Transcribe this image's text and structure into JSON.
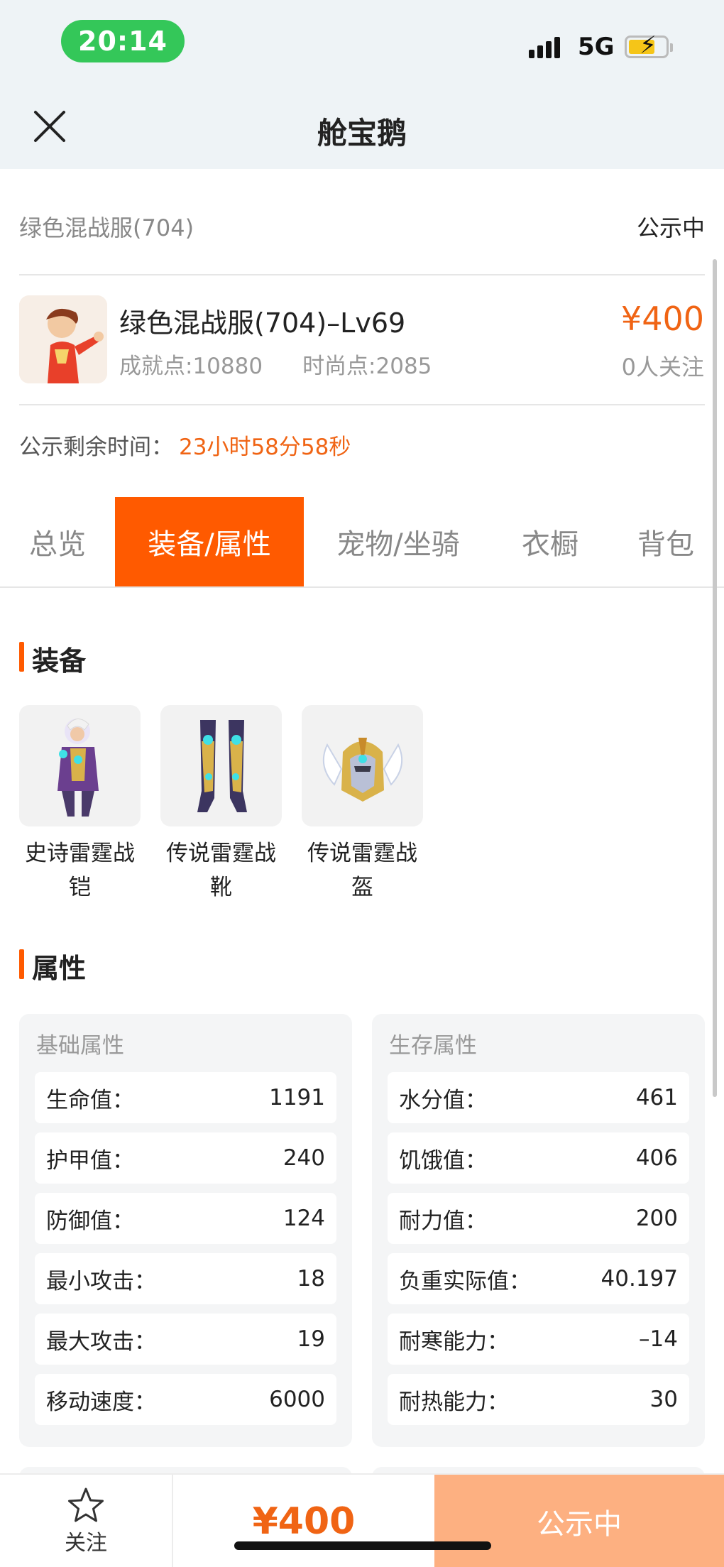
{
  "status_bar": {
    "time": "20:14",
    "network": "5G"
  },
  "nav": {
    "title": "舱宝鹅"
  },
  "server": {
    "name": "绿色混战服(704)",
    "status": "公示中"
  },
  "character": {
    "title": "绿色混战服(704)–Lv69",
    "achievement": "成就点:10880",
    "fashion": "时尚点:2085",
    "price": "¥400",
    "followers": "0人关注"
  },
  "remaining": {
    "label": "公示剩余时间：",
    "value": "23小时58分58秒"
  },
  "tabs": [
    "总览",
    "装备/属性",
    "宠物/坐骑",
    "衣橱",
    "背包"
  ],
  "equipment": {
    "title": "装备",
    "items": [
      {
        "name": "史诗雷霆战铠",
        "icon": "armor-icon"
      },
      {
        "name": "传说雷霆战靴",
        "icon": "boots-icon"
      },
      {
        "name": "传说雷霆战盔",
        "icon": "helmet-icon"
      }
    ]
  },
  "attributes": {
    "title": "属性",
    "base": {
      "title": "基础属性",
      "rows": [
        {
          "label": "生命值：",
          "value": "1191"
        },
        {
          "label": "护甲值：",
          "value": "240"
        },
        {
          "label": "防御值：",
          "value": "124"
        },
        {
          "label": "最小攻击：",
          "value": "18"
        },
        {
          "label": "最大攻击：",
          "value": "19"
        },
        {
          "label": "移动速度：",
          "value": "6000"
        }
      ]
    },
    "survival": {
      "title": "生存属性",
      "rows": [
        {
          "label": "水分值：",
          "value": "461"
        },
        {
          "label": "饥饿值：",
          "value": "406"
        },
        {
          "label": "耐力值：",
          "value": "200"
        },
        {
          "label": "负重实际值：",
          "value": "40.197"
        },
        {
          "label": "耐寒能力：",
          "value": "–14"
        },
        {
          "label": "耐热能力：",
          "value": "30"
        }
      ]
    }
  },
  "bottom_bar": {
    "follow_label": "关注",
    "price": "¥400",
    "status_button": "公示中"
  },
  "colors": {
    "accent": "#ff5a00",
    "price": "#f06414",
    "status_pill": "#34c759",
    "status_button": "#fdb081"
  }
}
